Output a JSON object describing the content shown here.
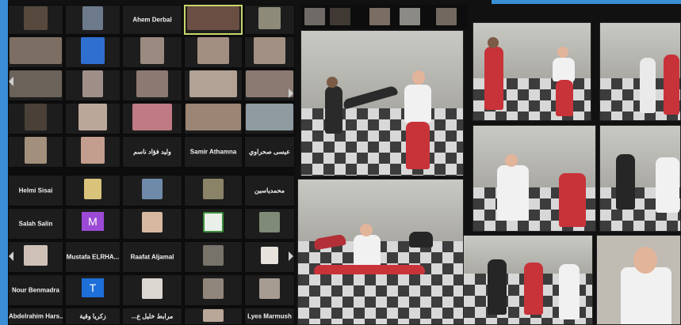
{
  "colors": {
    "accent": "#3a8fd6",
    "tile_bg": "#1d1d1d",
    "avatar_purple": "#9c4ad6",
    "avatar_blue": "#1e6fd9"
  },
  "grid": {
    "names": {
      "akrem": "Ahem Derbal",
      "samir": "Samir Athamna",
      "helmi": "Helmi Sisai",
      "salah": "Salah Salin",
      "mohamed_arabic": "محمدياسين",
      "oualid_arabic": "وليد فؤاد ناسم",
      "arabic_r3": "عيسى صحراوي",
      "mustafa": "Mustafa ELRHA...",
      "raafat": "Raafat Aljamal",
      "nour": "Nour Benmadra",
      "abdelrahim": "Abdelrahim Hars...",
      "zakaria": "زكريا وقية",
      "mrabet": "...مرابط خليل ع",
      "lyes": "Lyes Marmush"
    },
    "avatar_letters": {
      "m": "M",
      "t": "T"
    }
  },
  "icons": {
    "left_arrow": "chevron-left-icon",
    "right_arrow": "chevron-right-icon"
  }
}
